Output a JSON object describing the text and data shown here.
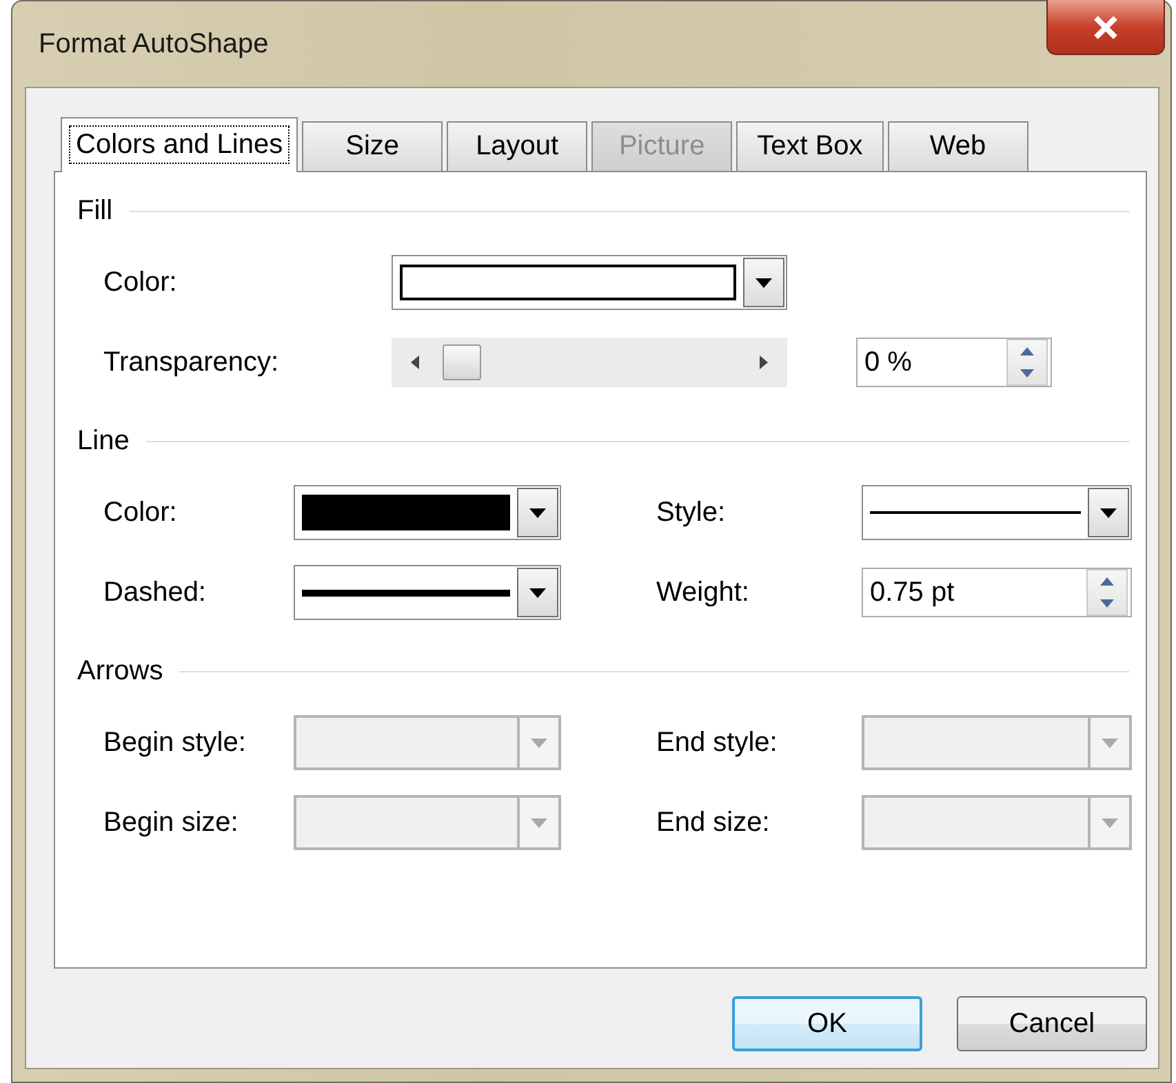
{
  "window": {
    "title": "Format AutoShape"
  },
  "tabs": [
    {
      "label": "Colors and Lines",
      "selected": true,
      "disabled": false
    },
    {
      "label": "Size",
      "selected": false,
      "disabled": false
    },
    {
      "label": "Layout",
      "selected": false,
      "disabled": false
    },
    {
      "label": "Picture",
      "selected": false,
      "disabled": true
    },
    {
      "label": "Text Box",
      "selected": false,
      "disabled": false
    },
    {
      "label": "Web",
      "selected": false,
      "disabled": false
    }
  ],
  "sections": [
    {
      "title": "Fill",
      "kind": "single",
      "fields": [
        {
          "kind": "color",
          "label": "Color:",
          "color": "#ffffff",
          "disabled": false
        },
        {
          "kind": "slider",
          "label": "Transparency:",
          "level": 0,
          "value": "0 %"
        }
      ]
    },
    {
      "title": "Line",
      "kind": "pairs",
      "fields": [
        {
          "kind": "color",
          "label": "Color:",
          "color": "#000000",
          "disabled": false
        },
        {
          "kind": "line",
          "label": "Style:",
          "thick": false,
          "disabled": false
        },
        {
          "kind": "line",
          "label": "Dashed:",
          "thick": true,
          "disabled": false
        },
        {
          "kind": "spin",
          "label": "Weight:",
          "value": "0.75 pt"
        }
      ]
    },
    {
      "title": "Arrows",
      "kind": "pairs",
      "fields": [
        {
          "kind": "dropdown",
          "label": "Begin style:",
          "disabled": true
        },
        {
          "kind": "dropdown",
          "label": "End style:",
          "disabled": true
        },
        {
          "kind": "dropdown",
          "label": "Begin size:",
          "disabled": true
        },
        {
          "kind": "dropdown",
          "label": "End size:",
          "disabled": true
        }
      ]
    }
  ],
  "buttons": [
    {
      "label": "OK",
      "default": true
    },
    {
      "label": "Cancel",
      "default": false
    }
  ]
}
